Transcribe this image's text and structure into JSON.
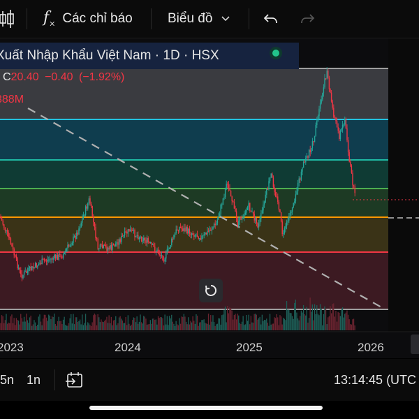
{
  "toolbar": {
    "indicators_label": "Các chỉ báo",
    "chart_label": "Biểu đồ"
  },
  "symbol": {
    "title": "Xuất Nhập Khẩu Việt Nam · 1D · HSX"
  },
  "ohlc": {
    "close_prefix": "C",
    "close": "20.40",
    "change": "−0.40",
    "change_pct": "(−1.92%)"
  },
  "volume": {
    "value": "388M"
  },
  "x_axis": {
    "labels": [
      "2023",
      "2024",
      "2025",
      "2026"
    ]
  },
  "bottom": {
    "interval_5": "5n",
    "interval_1": "1n",
    "time": "13:14:45 (UTC"
  },
  "colors": {
    "up": "#26a69a",
    "down": "#f23645",
    "fib_cyan": "#22c2e0",
    "fib_teal": "#1fb9a3",
    "fib_green": "#4caf50",
    "fib_orange": "#ff9800",
    "fib_red": "#f23645",
    "fib_gray": "#9e9e9e"
  },
  "icons": [
    "candles-icon",
    "fx-icon",
    "chevron-down-icon",
    "undo-icon",
    "redo-icon",
    "reset-icon",
    "calendar-range-icon"
  ]
}
